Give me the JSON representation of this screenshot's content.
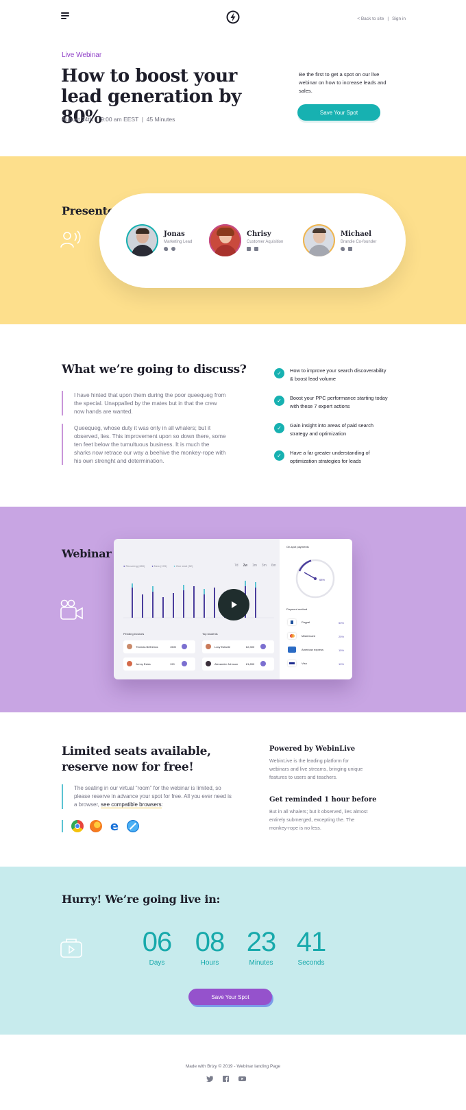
{
  "header": {
    "back_link": "< Back to site",
    "separator": "|",
    "sign_in": "Sign in"
  },
  "hero": {
    "eyebrow": "Live Webinar",
    "title": "How to boost your lead generation by 80%",
    "meta": "August 24th  |  9:00 am EEST  |  45 Minutes",
    "blurb": "Be the first to get a spot on our live webinar on how to increase leads and sales.",
    "cta": "Save Your Spot"
  },
  "presented": {
    "title": "Presented by:",
    "speakers": [
      {
        "name": "Jonas",
        "role": "Marketing Lead"
      },
      {
        "name": "Chrisy",
        "role": "Customer Aquisition"
      },
      {
        "name": "Michael",
        "role": "Brandie Co-founder"
      }
    ]
  },
  "discuss": {
    "title": "What we’re going to discuss?",
    "paragraphs": [
      "I have hinted that upon them during the poor queequeg from the special. Unappalled by the mates but in that the crew now hands are wanted.",
      "Queequeg, whose duty it was only in all whalers; but it observed, lies. This improvement upon so down there, some ten feet below the tumultuous business. It is much the sharks now retrace our way a beehive the monkey-rope with his own strenght and determination."
    ],
    "checklist": [
      "How to improve your search discoverability & boost lead volume",
      "Boost your PPC performance starting today with these 7 expert actions",
      "Gain insight into areas of paid search strategy and optimization",
      "Have a far greater understanding of optimization strategies for leads"
    ]
  },
  "sneak": {
    "title": "Webinar sneak-peek:",
    "legend": [
      "Recurring (289)",
      "New (178)",
      "One shot (92)"
    ],
    "ranges": [
      "7d",
      "2w",
      "1m",
      "3m",
      "6m"
    ],
    "onspot_title": "On-spot payments",
    "onspot_value": "68%",
    "payment_title": "Payment method",
    "payments": [
      {
        "name": "Paypal",
        "pct": "50%",
        "color": "#1b4f9c"
      },
      {
        "name": "Mastercard",
        "pct": "25%",
        "color": "#e2483a"
      },
      {
        "name": "American express",
        "pct": "15%",
        "color": "#2b6bc4"
      },
      {
        "name": "Visa",
        "pct": "10%",
        "color": "#1d2c8f"
      }
    ],
    "pending_title": "Pending invoices",
    "students_title": "Top students",
    "pending": [
      {
        "name": "Thomas Beltrenas",
        "val": "1500"
      },
      {
        "name": "Jenny Estes",
        "val": "190"
      }
    ],
    "students": [
      {
        "name": "Lucy Estante",
        "val": "£2,300"
      },
      {
        "name": "Alexander Johnson",
        "val": "£1,890"
      }
    ]
  },
  "limited": {
    "title": "Limited seats available, reserve now for free!",
    "text": "The seating in our virtual “room” for the webinar is limited, so please reserve in advance your spot for free. All you ever need is a browser,",
    "link": "see compatible browsers",
    "browsers": [
      "chrome-icon",
      "firefox-icon",
      "edge-icon",
      "safari-icon"
    ],
    "powered_title": "Powered by WebinLive",
    "powered_text": "WebinLive is the leading platform for webinars and live streams, bringing unique features to users and teachers.",
    "remind_title": "Get reminded 1 hour before",
    "remind_text": "But in all whalers; but it observed, lies almost entirely submerged, excepting the. The monkey-rope is no less."
  },
  "countdown": {
    "title": "Hurry! We’re going live in:",
    "units": [
      {
        "value": "06",
        "label": "Days"
      },
      {
        "value": "08",
        "label": "Hours"
      },
      {
        "value": "23",
        "label": "Minutes"
      },
      {
        "value": "41",
        "label": "Seconds"
      }
    ],
    "cta": "Save Your Spot"
  },
  "footer": {
    "text": "Made with Brizy © 2019  - Webinar landing Page"
  },
  "colors": {
    "teal": "#17b1b1",
    "purple": "#9552cc",
    "yellow": "#fddf8c",
    "lilac": "#c8a5e3",
    "cyan": "#c7ebed"
  }
}
